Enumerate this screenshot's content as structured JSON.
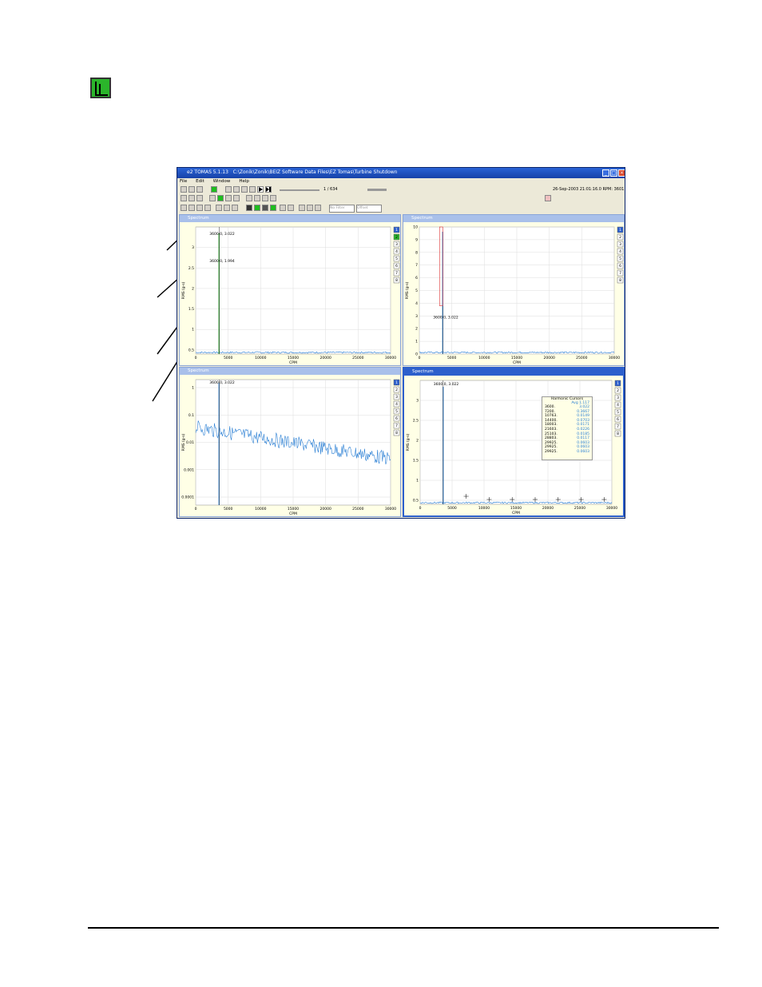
{
  "app": {
    "title": "e2 TOMAS 5.1.13",
    "path": "C:\\Zonik\\Zonik\\BEIZ Software Data Files\\EZ Tomas\\Turbine Shutdown",
    "menus": [
      "File",
      "Edit",
      "Window",
      "Help"
    ],
    "frame_counter": "1 / 634",
    "status": "26-Sep-2003 21:01:16.0  RPM: 3601",
    "combo_filter": "No Filter",
    "combo_mode": "Offset"
  },
  "panes": [
    {
      "title": "Spectrum",
      "ylabel": "RMS (g-s)",
      "xlabel": "CPM",
      "xticks": [
        "0",
        "5000",
        "10000",
        "15000",
        "20000",
        "25000",
        "30000"
      ],
      "yticks": [
        "3",
        "2.5",
        "2",
        "1.5",
        "1",
        "0.5"
      ],
      "cursor_labels": [
        "3600.0, 3.022",
        "3600.0, 1.994"
      ],
      "channels": [
        "1",
        "2",
        "3",
        "4",
        "5",
        "6",
        "7",
        "8"
      ]
    },
    {
      "title": "Spectrum",
      "ylabel": "RMS (g-s)",
      "xlabel": "CPM",
      "xticks": [
        "0",
        "5000",
        "10000",
        "15000",
        "20000",
        "25000",
        "30000"
      ],
      "yticks": [
        "10",
        "9",
        "8",
        "7",
        "6",
        "5",
        "4",
        "3",
        "2",
        "1",
        "0"
      ],
      "cursor_labels": [
        "3600.0, 3.022"
      ],
      "channels": [
        "1",
        "2",
        "3",
        "4",
        "5",
        "6",
        "7",
        "8"
      ]
    },
    {
      "title": "Spectrum",
      "ylabel": "RMS (g-s)",
      "xlabel": "CPM",
      "xticks": [
        "0",
        "5000",
        "10000",
        "15000",
        "20000",
        "25000",
        "30000"
      ],
      "yticks": [
        "1",
        "0.1",
        "0.01",
        "0.001",
        "0.0001"
      ],
      "cursor_labels": [
        "3600.0, 3.022"
      ],
      "channels": [
        "1",
        "2",
        "3",
        "4",
        "5",
        "6",
        "7",
        "8"
      ]
    },
    {
      "title": "Spectrum",
      "ylabel": "RMS (g-s)",
      "xlabel": "CPM",
      "xticks": [
        "0",
        "5000",
        "10000",
        "15000",
        "20000",
        "25000",
        "30000"
      ],
      "yticks": [
        "3",
        "2.5",
        "2",
        "1.5",
        "1",
        "0.5"
      ],
      "cursor_labels": [
        "3600.0, 3.022"
      ],
      "channels": [
        "1",
        "2",
        "3",
        "4",
        "5",
        "6",
        "7",
        "8"
      ],
      "harmonic": {
        "title": "Harmonic Cursors",
        "header": "Avg 1.117",
        "rows": [
          [
            "3600.",
            "3.022"
          ],
          [
            "7200.",
            "0.3667"
          ],
          [
            "10763.",
            "0.0149"
          ],
          [
            "14400.",
            "0.0703"
          ],
          [
            "18003.",
            "0.0171"
          ],
          [
            "21603.",
            "0.0226"
          ],
          [
            "25103.",
            "0.0185"
          ],
          [
            "28803.",
            "0.0117"
          ],
          [
            "29925.",
            "0.0603"
          ],
          [
            "29925.",
            "0.0603"
          ],
          [
            "29925.",
            "0.0603"
          ]
        ]
      }
    }
  ]
}
